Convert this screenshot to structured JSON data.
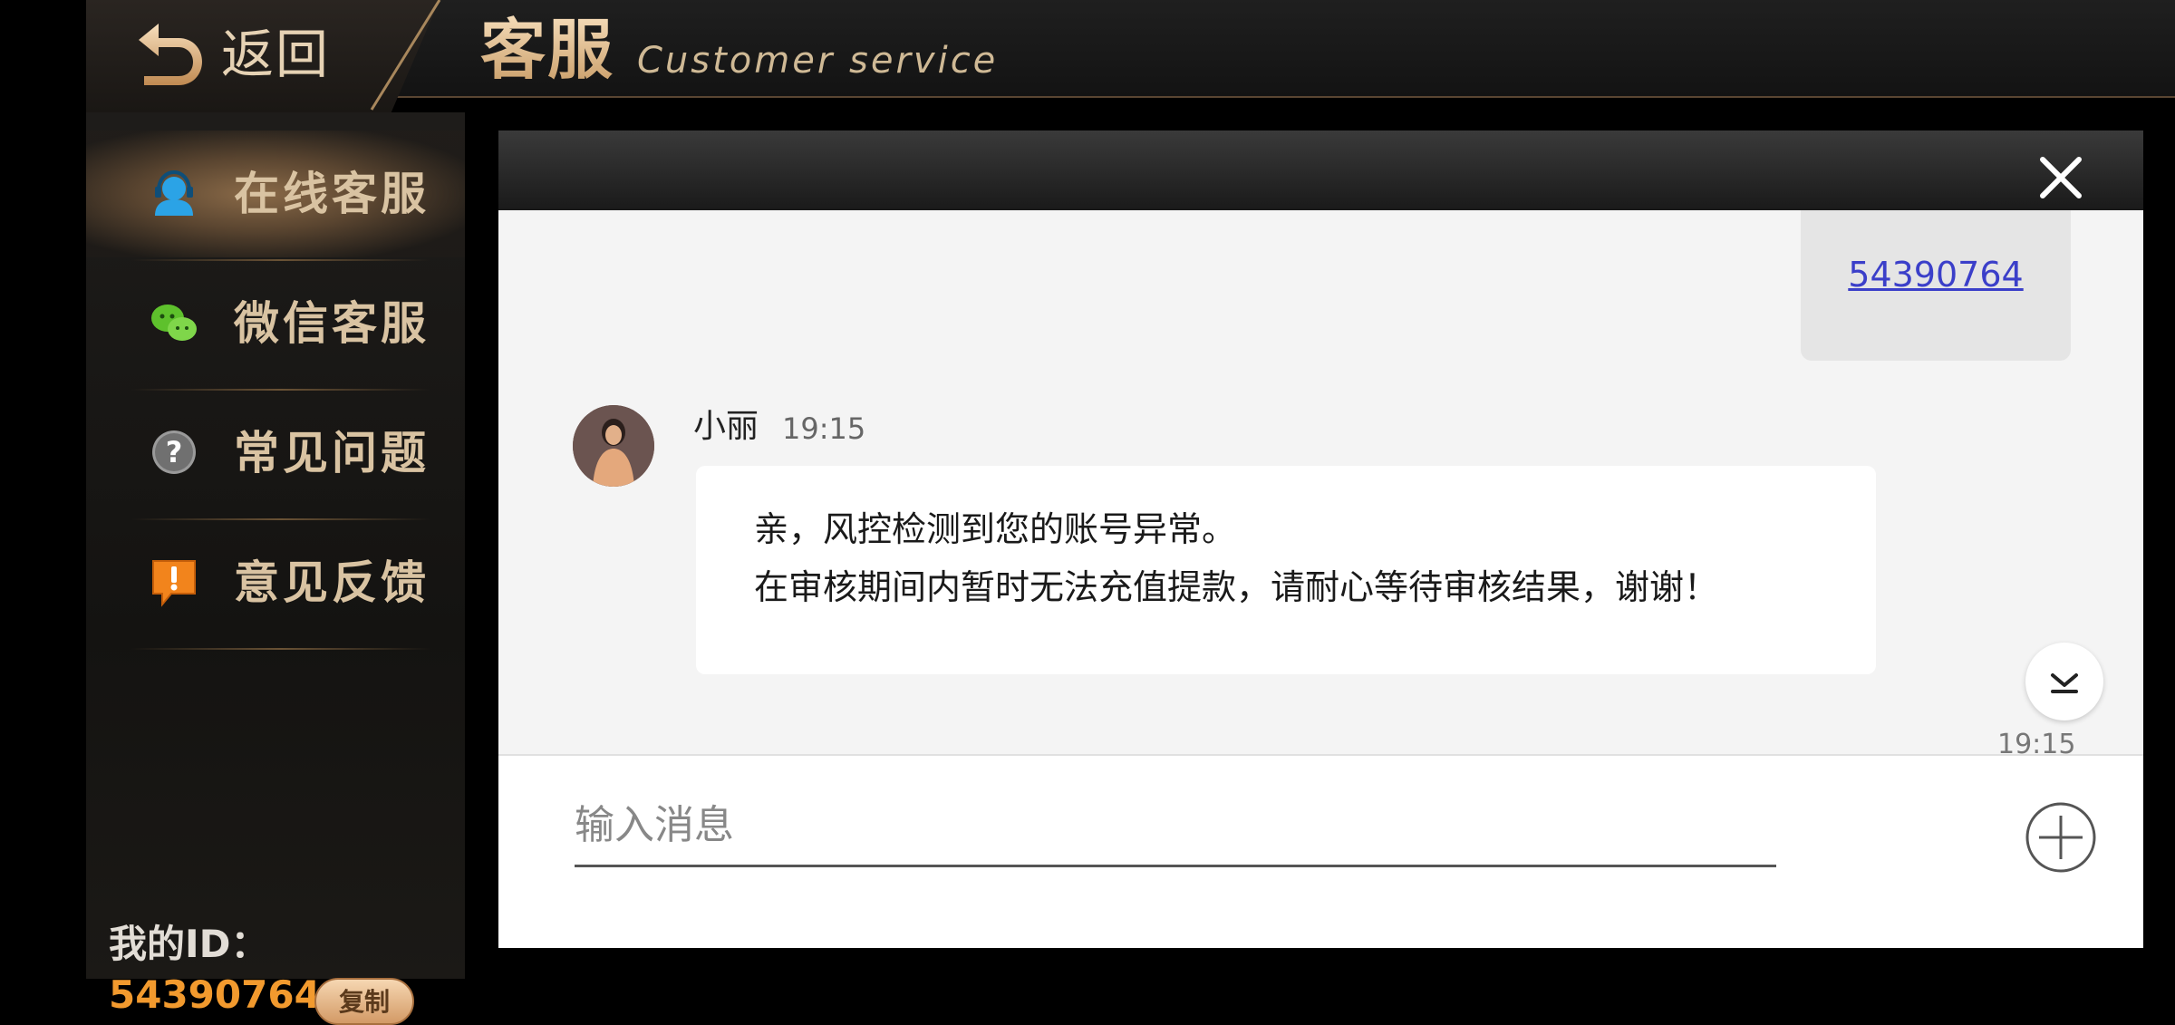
{
  "header": {
    "back_label": "返回",
    "title": "客服",
    "subtitle": "Customer service"
  },
  "sidebar": {
    "items": [
      {
        "label": "在线客服",
        "icon": "headset-icon",
        "active": true
      },
      {
        "label": "微信客服",
        "icon": "wechat-icon",
        "active": false
      },
      {
        "label": "常见问题",
        "icon": "question-icon",
        "active": false
      },
      {
        "label": "意见反馈",
        "icon": "feedback-icon",
        "active": false
      }
    ],
    "id_label": "我的ID：",
    "id_value": "54390764",
    "copy_label": "复制"
  },
  "chat": {
    "user_message": "54390764",
    "agent_name": "小丽",
    "agent_time": "19:15",
    "agent_message_line1": "亲，风控检测到您的账号异常。",
    "agent_message_line2": "在审核期间内暂时无法充值提款，请耐心等待审核结果，谢谢！",
    "bottom_time": "19:15",
    "input_placeholder": "输入消息"
  },
  "colors": {
    "accent_gold": "#e8c79a",
    "id_orange": "#f29a2e",
    "link_blue": "#3b3fc9"
  }
}
